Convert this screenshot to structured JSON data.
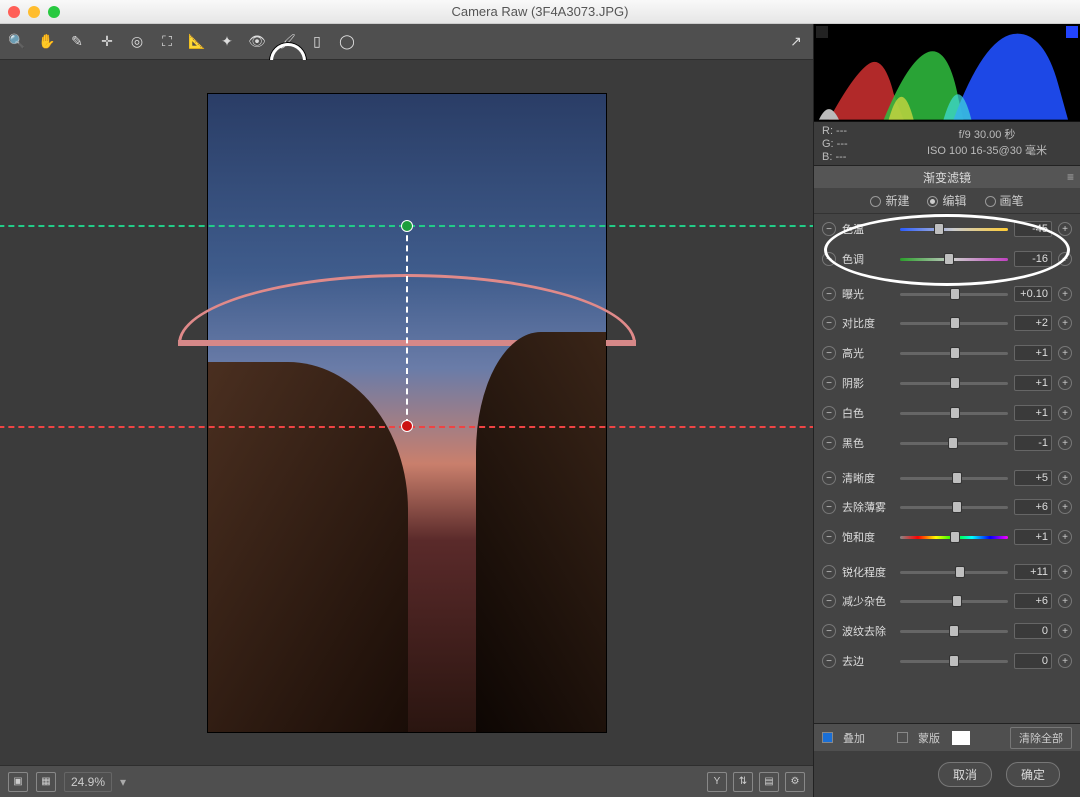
{
  "window": {
    "title": "Camera Raw (3F4A3073.JPG)"
  },
  "toolbar": {
    "tools": [
      {
        "name": "zoom-tool",
        "glyph": "🔍"
      },
      {
        "name": "hand-tool",
        "glyph": "✋"
      },
      {
        "name": "white-balance-tool",
        "glyph": "✎"
      },
      {
        "name": "color-sampler-tool",
        "glyph": "✛"
      },
      {
        "name": "targeted-adjustment-tool",
        "glyph": "◎"
      },
      {
        "name": "crop-tool",
        "glyph": "⛶"
      },
      {
        "name": "straighten-tool",
        "glyph": "📐"
      },
      {
        "name": "spot-removal-tool",
        "glyph": "✦"
      },
      {
        "name": "red-eye-tool",
        "glyph": "👁"
      },
      {
        "name": "adjustment-brush-tool",
        "glyph": "🖌"
      },
      {
        "name": "graduated-filter-tool",
        "glyph": "▯"
      },
      {
        "name": "radial-filter-tool",
        "glyph": "◯"
      }
    ],
    "right_tool": {
      "name": "preferences",
      "glyph": "↗"
    }
  },
  "bottombar": {
    "zoom": "24.9%",
    "icons": [
      "Y",
      "⇅",
      "▤",
      "⚙"
    ]
  },
  "meta": {
    "R": "R:   ---",
    "G": "G:   ---",
    "B": "B:   ---",
    "line1": "f/9   30.00 秒",
    "line2": "ISO 100   16-35@30 毫米"
  },
  "panel": {
    "title": "渐变滤镜",
    "modes": [
      {
        "label": "新建",
        "selected": false
      },
      {
        "label": "编辑",
        "selected": true
      },
      {
        "label": "画笔",
        "selected": false
      }
    ]
  },
  "sliders": [
    {
      "id": "temperature",
      "label": "色温",
      "value": "-45",
      "pos": 36,
      "bar": "temp"
    },
    {
      "id": "tint",
      "label": "色调",
      "value": "-16",
      "pos": 45,
      "bar": "tint"
    },
    {
      "id": "exposure",
      "label": "曝光",
      "value": "+0.10",
      "pos": 51,
      "gap": true
    },
    {
      "id": "contrast",
      "label": "对比度",
      "value": "+2",
      "pos": 51
    },
    {
      "id": "highlights",
      "label": "高光",
      "value": "+1",
      "pos": 51
    },
    {
      "id": "shadows",
      "label": "阴影",
      "value": "+1",
      "pos": 51
    },
    {
      "id": "whites",
      "label": "白色",
      "value": "+1",
      "pos": 51
    },
    {
      "id": "blacks",
      "label": "黑色",
      "value": "-1",
      "pos": 49
    },
    {
      "id": "clarity",
      "label": "清晰度",
      "value": "+5",
      "pos": 53,
      "gap": true
    },
    {
      "id": "dehaze",
      "label": "去除薄雾",
      "value": "+6",
      "pos": 53
    },
    {
      "id": "saturation",
      "label": "饱和度",
      "value": "+1",
      "pos": 51,
      "bar": "sat"
    },
    {
      "id": "sharpness",
      "label": "锐化程度",
      "value": "+11",
      "pos": 56,
      "gap": true
    },
    {
      "id": "noise-reduction",
      "label": "减少杂色",
      "value": "+6",
      "pos": 53
    },
    {
      "id": "moire",
      "label": "波纹去除",
      "value": "0",
      "pos": 50
    },
    {
      "id": "defringe",
      "label": "去边",
      "value": "0",
      "pos": 50
    }
  ],
  "footer": {
    "overlay_label": "叠加",
    "overlay_checked": true,
    "mask_label": "蒙版",
    "mask_checked": false,
    "clear": "清除全部"
  },
  "buttons": {
    "cancel": "取消",
    "ok": "确定"
  }
}
